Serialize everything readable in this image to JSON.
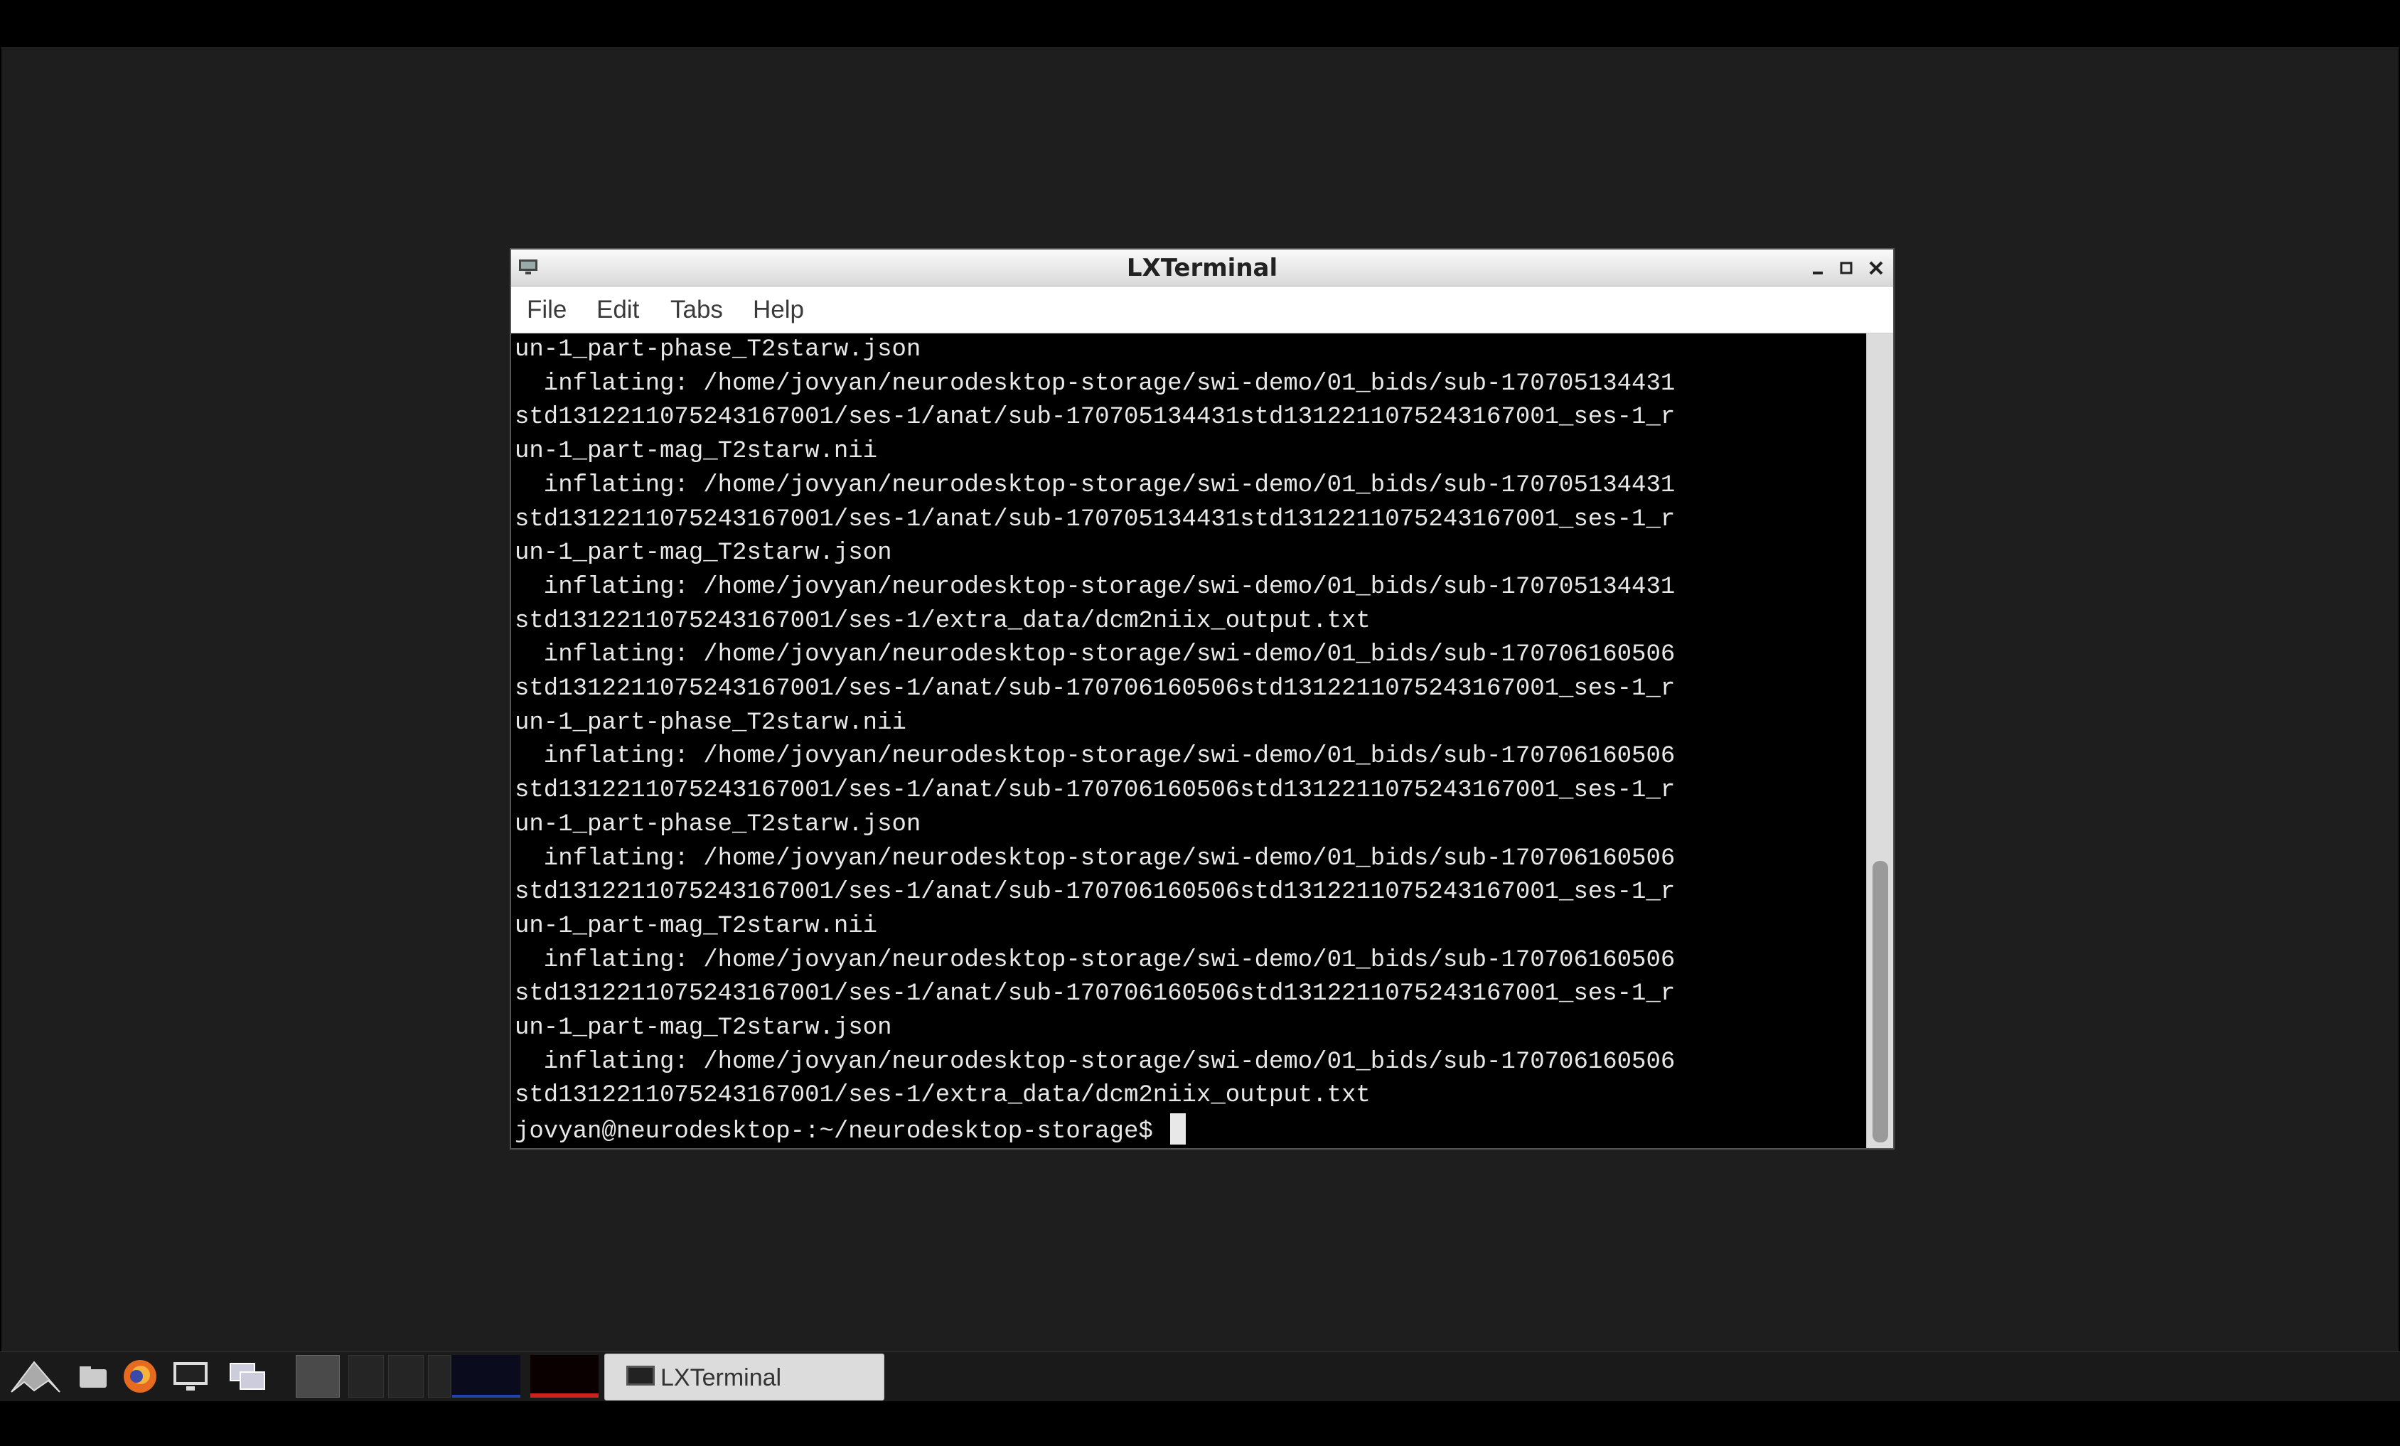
{
  "window": {
    "title": "LXTerminal",
    "menu": [
      "File",
      "Edit",
      "Tabs",
      "Help"
    ]
  },
  "terminal": {
    "lines": [
      "un-1_part-phase_T2starw.json",
      "  inflating: /home/jovyan/neurodesktop-storage/swi-demo/01_bids/sub-170705134431",
      "std1312211075243167001/ses-1/anat/sub-170705134431std1312211075243167001_ses-1_r",
      "un-1_part-mag_T2starw.nii",
      "  inflating: /home/jovyan/neurodesktop-storage/swi-demo/01_bids/sub-170705134431",
      "std1312211075243167001/ses-1/anat/sub-170705134431std1312211075243167001_ses-1_r",
      "un-1_part-mag_T2starw.json",
      "  inflating: /home/jovyan/neurodesktop-storage/swi-demo/01_bids/sub-170705134431",
      "std1312211075243167001/ses-1/extra_data/dcm2niix_output.txt",
      "  inflating: /home/jovyan/neurodesktop-storage/swi-demo/01_bids/sub-170706160506",
      "std1312211075243167001/ses-1/anat/sub-170706160506std1312211075243167001_ses-1_r",
      "un-1_part-phase_T2starw.nii",
      "  inflating: /home/jovyan/neurodesktop-storage/swi-demo/01_bids/sub-170706160506",
      "std1312211075243167001/ses-1/anat/sub-170706160506std1312211075243167001_ses-1_r",
      "un-1_part-phase_T2starw.json",
      "  inflating: /home/jovyan/neurodesktop-storage/swi-demo/01_bids/sub-170706160506",
      "std1312211075243167001/ses-1/anat/sub-170706160506std1312211075243167001_ses-1_r",
      "un-1_part-mag_T2starw.nii",
      "  inflating: /home/jovyan/neurodesktop-storage/swi-demo/01_bids/sub-170706160506",
      "std1312211075243167001/ses-1/anat/sub-170706160506std1312211075243167001_ses-1_r",
      "un-1_part-mag_T2starw.json",
      "  inflating: /home/jovyan/neurodesktop-storage/swi-demo/01_bids/sub-170706160506",
      "std1312211075243167001/ses-1/extra_data/dcm2niix_output.txt"
    ],
    "prompt": "jovyan@neurodesktop-:~/neurodesktop-storage$ "
  },
  "taskbar": {
    "task_label": "LXTerminal",
    "icons": [
      "menu-icon",
      "files-icon",
      "browser-icon",
      "terminal-icon",
      "windows-icon"
    ]
  },
  "colors": {
    "terminal_bg": "#000000",
    "terminal_fg": "#e8e8e8",
    "desktop_bg": "#1e1e1e"
  }
}
